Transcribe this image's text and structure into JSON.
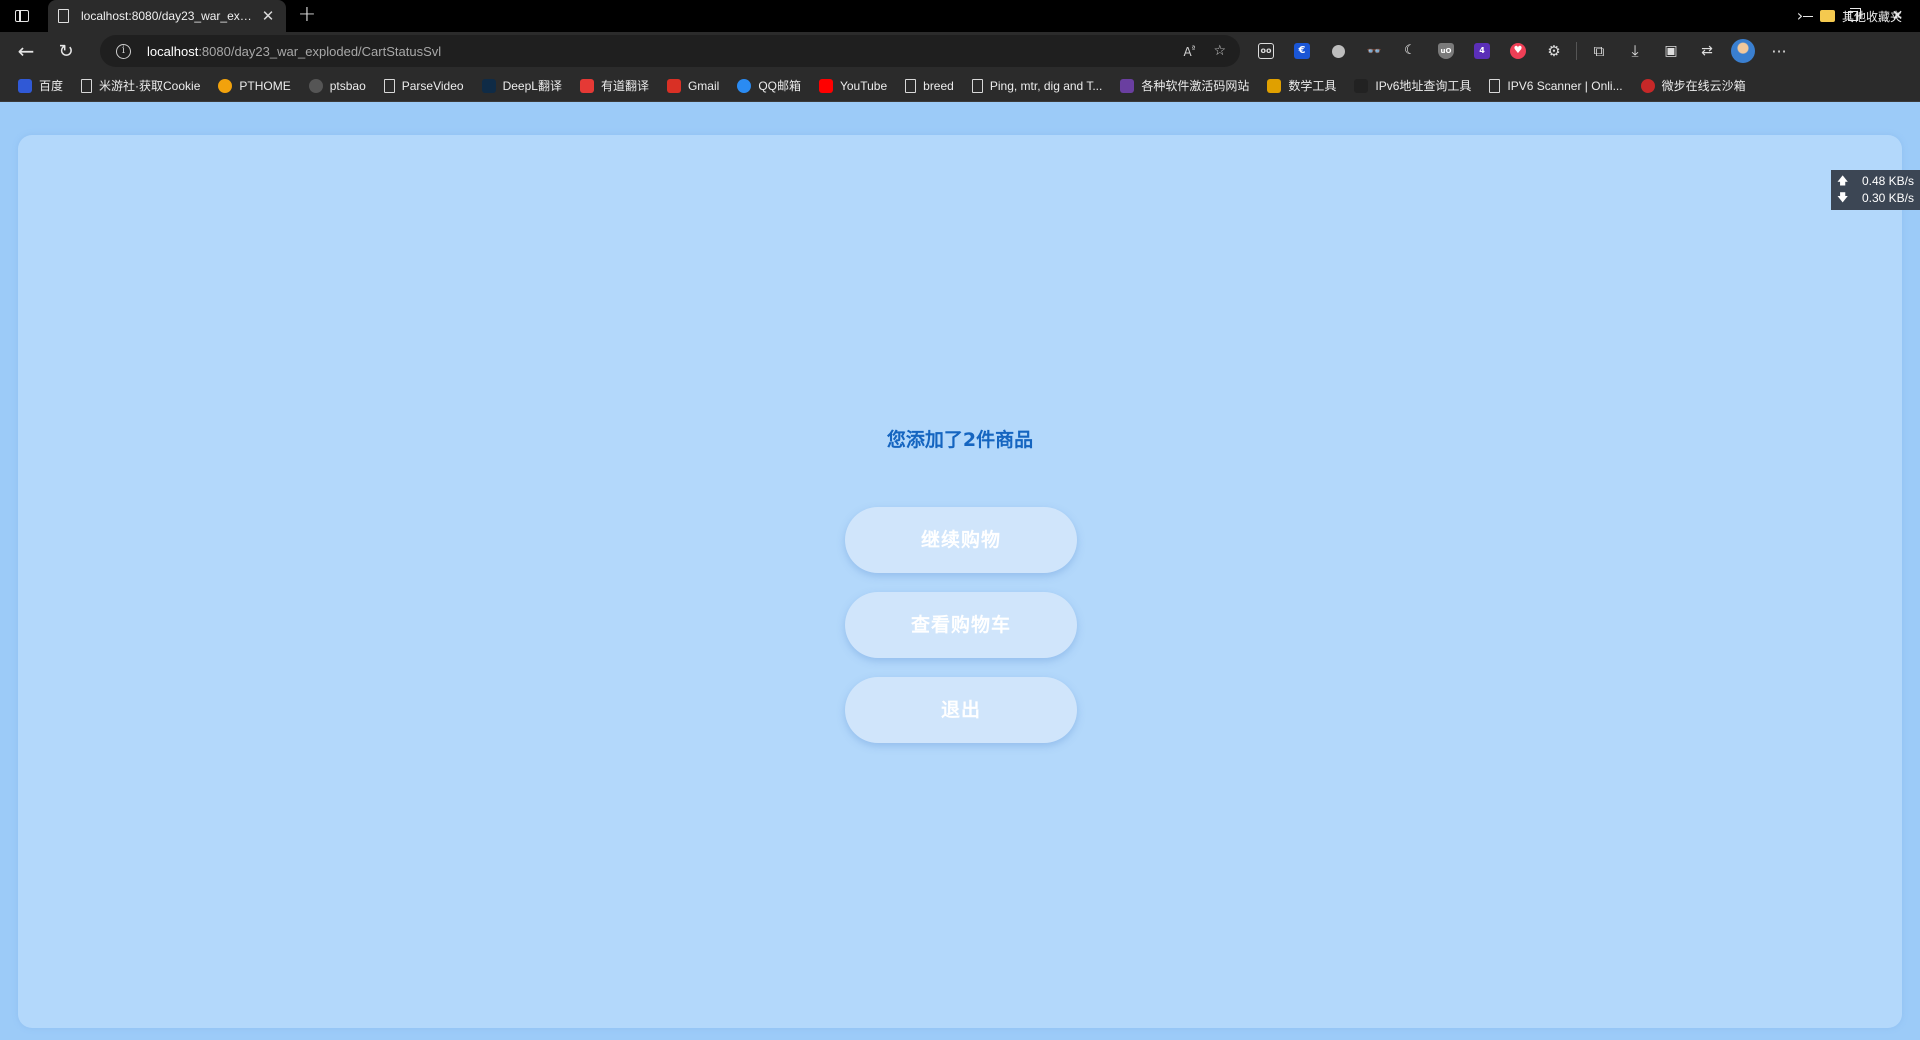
{
  "browser": {
    "tab": {
      "title": "localhost:8080/day23_war_exploded/CartStatusSvl",
      "close_glyph": "✕"
    },
    "new_tab_glyph": "+",
    "address": {
      "host": "localhost",
      "rest": ":8080/day23_war_exploded/CartStatusSvl"
    },
    "bookmarks": [
      {
        "label": "百度",
        "icon": "baidu-icon",
        "color": "#3059d6"
      },
      {
        "label": "米游社·获取Cookie",
        "icon": "page-icon"
      },
      {
        "label": "PTHOME",
        "icon": "pthome-icon",
        "color": "#f2a20c"
      },
      {
        "label": "ptsbao",
        "icon": "ptsbao-icon",
        "color": "#555555"
      },
      {
        "label": "ParseVideo",
        "icon": "page-icon"
      },
      {
        "label": "DeepL翻译",
        "icon": "deepl-icon",
        "color": "#0f2b46"
      },
      {
        "label": "有道翻译",
        "icon": "youdao-icon",
        "color": "#e53935"
      },
      {
        "label": "Gmail",
        "icon": "gmail-icon",
        "color": "#d93025"
      },
      {
        "label": "QQ邮箱",
        "icon": "qqmail-icon",
        "color": "#2a8bf2"
      },
      {
        "label": "YouTube",
        "icon": "youtube-icon",
        "color": "#ff0000"
      },
      {
        "label": "breed",
        "icon": "page-icon"
      },
      {
        "label": "Ping, mtr, dig and T...",
        "icon": "page-icon"
      },
      {
        "label": "各种软件激活码网站",
        "icon": "activation-icon",
        "color": "#6a3fa0"
      },
      {
        "label": "数学工具",
        "icon": "pi-icon",
        "color": "#e0a000"
      },
      {
        "label": "IPv6地址查询工具",
        "icon": "zx-icon",
        "color": "#222222"
      },
      {
        "label": "IPV6 Scanner | Onli...",
        "icon": "page-icon"
      },
      {
        "label": "微步在线云沙箱",
        "icon": "threatbook-icon",
        "color": "#c62828"
      }
    ],
    "bookmarks_more": "›",
    "other_bookmarks": "其他收藏夹"
  },
  "page": {
    "message": "您添加了2件商品",
    "buttons": {
      "continue": "继续购物",
      "view_cart": "查看购物车",
      "logout": "退出"
    }
  },
  "net_speed": {
    "up": "0.48 KB/s",
    "down": "0.30 KB/s"
  }
}
